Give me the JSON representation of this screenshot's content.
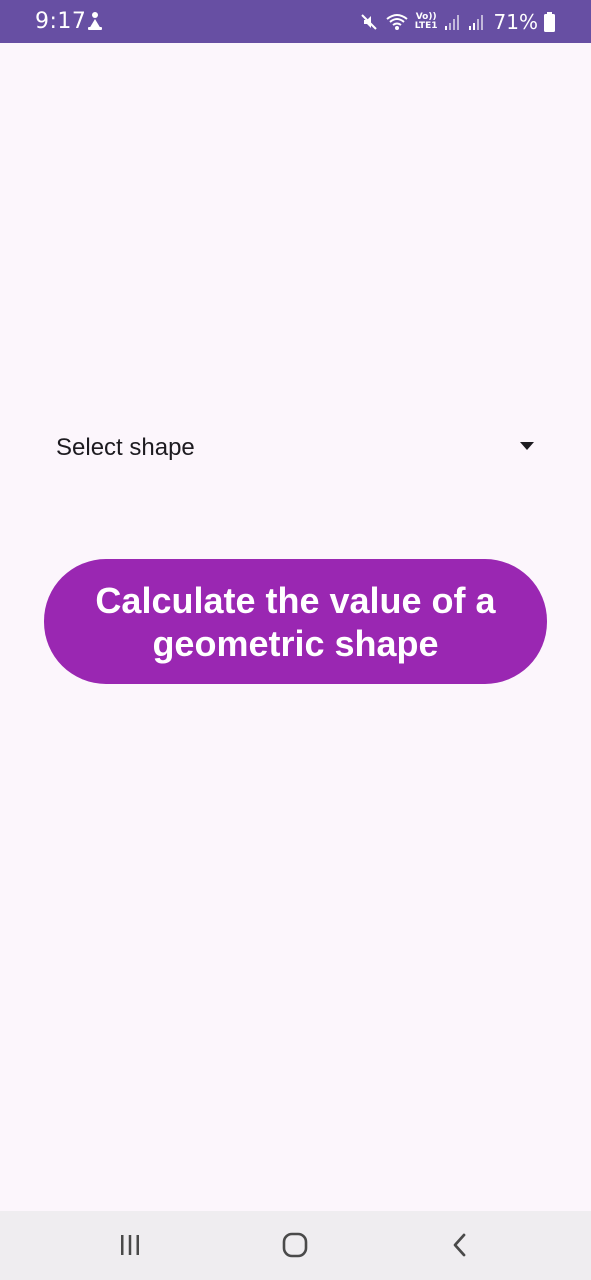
{
  "status_bar": {
    "time": "9:17",
    "network_label_top": "Vo))",
    "network_label_bottom": "LTE1",
    "battery": "71%",
    "background_color": "#674FA3"
  },
  "dropdown": {
    "label": "Select shape"
  },
  "main_button": {
    "label": "Calculate the value of a geometric shape",
    "background_color": "#9A27B2"
  },
  "nav_bar": {
    "recents_icon": "recents-icon",
    "home_icon": "home-icon",
    "back_icon": "back-icon"
  },
  "colors": {
    "page_background": "#FCF6FC",
    "nav_background": "#EFEDF0"
  }
}
